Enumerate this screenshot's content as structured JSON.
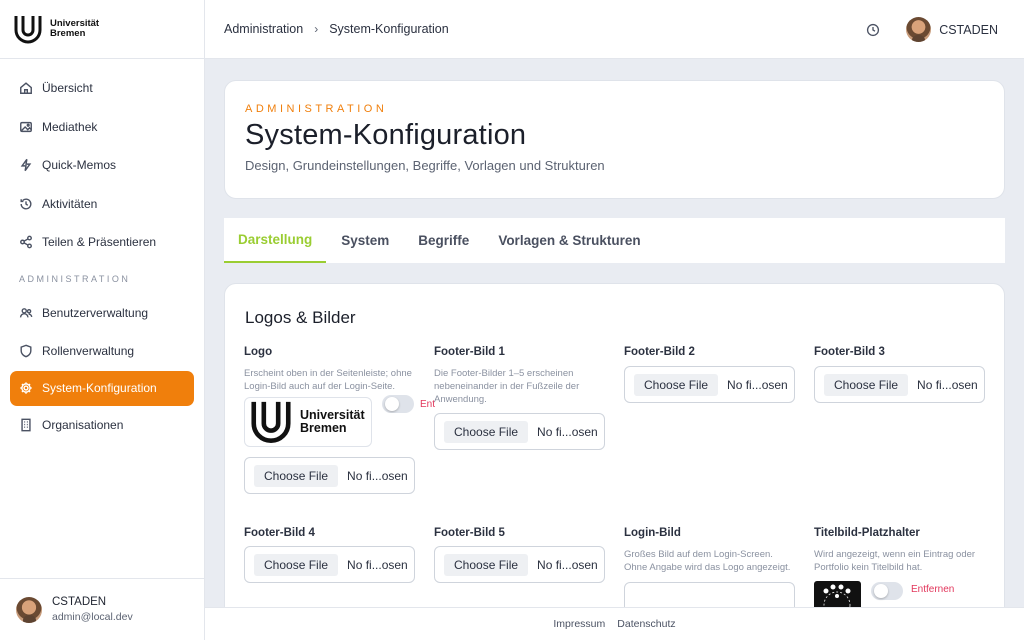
{
  "brand": {
    "line1": "Universität",
    "line2": "Bremen"
  },
  "sidebar": {
    "items": [
      {
        "label": "Übersicht",
        "icon": "home-icon"
      },
      {
        "label": "Mediathek",
        "icon": "image-icon"
      },
      {
        "label": "Quick-Memos",
        "icon": "bolt-icon"
      },
      {
        "label": "Aktivitäten",
        "icon": "history-icon"
      },
      {
        "label": "Teilen & Präsentieren",
        "icon": "share-icon"
      }
    ],
    "section_label": "ADMINISTRATION",
    "admin_items": [
      {
        "label": "Benutzerverwaltung",
        "icon": "users-icon"
      },
      {
        "label": "Rollenverwaltung",
        "icon": "shield-icon"
      },
      {
        "label": "System-Konfiguration",
        "icon": "gear-icon",
        "active": true
      },
      {
        "label": "Organisationen",
        "icon": "building-icon"
      }
    ],
    "user": {
      "name": "CSTADEN",
      "email": "admin@local.dev"
    }
  },
  "topbar": {
    "breadcrumb": [
      "Administration",
      "System-Konfiguration"
    ],
    "user": "CSTADEN"
  },
  "hero": {
    "eyebrow": "ADMINISTRATION",
    "title": "System-Konfiguration",
    "subtitle": "Design, Grundeinstellungen, Begriffe, Vorlagen und Strukturen"
  },
  "tabs": [
    {
      "label": "Darstellung",
      "active": true
    },
    {
      "label": "System"
    },
    {
      "label": "Begriffe"
    },
    {
      "label": "Vorlagen & Strukturen"
    }
  ],
  "section": {
    "title": "Logos & Bilder",
    "choose_label": "Choose File",
    "no_file_label": "No fi...osen",
    "remove_label": "Entfernen",
    "remove_label_cut": "Ent",
    "fields": {
      "logo": {
        "label": "Logo",
        "desc": "Erscheint oben in der Seitenleiste; ohne Login-Bild auch auf der Login-Seite."
      },
      "footer1": {
        "label": "Footer-Bild 1",
        "desc": "Die Footer-Bilder 1–5 erscheinen nebeneinander in der Fußzeile der Anwendung."
      },
      "footer2": {
        "label": "Footer-Bild 2"
      },
      "footer3": {
        "label": "Footer-Bild 3"
      },
      "footer4": {
        "label": "Footer-Bild 4"
      },
      "footer5": {
        "label": "Footer-Bild 5"
      },
      "login": {
        "label": "Login-Bild",
        "desc": "Großes Bild auf dem Login-Screen. Ohne Angabe wird das Logo angezeigt."
      },
      "titelbild": {
        "label": "Titelbild-Platzhalter",
        "desc": "Wird angezeigt, wenn ein Eintrag oder Portfolio kein Titelbild hat."
      }
    }
  },
  "footer": {
    "links": [
      "Impressum",
      "Datenschutz"
    ]
  },
  "colors": {
    "accent": "#f07f0c",
    "tab_active": "#9acd32",
    "danger": "#e2365b"
  }
}
